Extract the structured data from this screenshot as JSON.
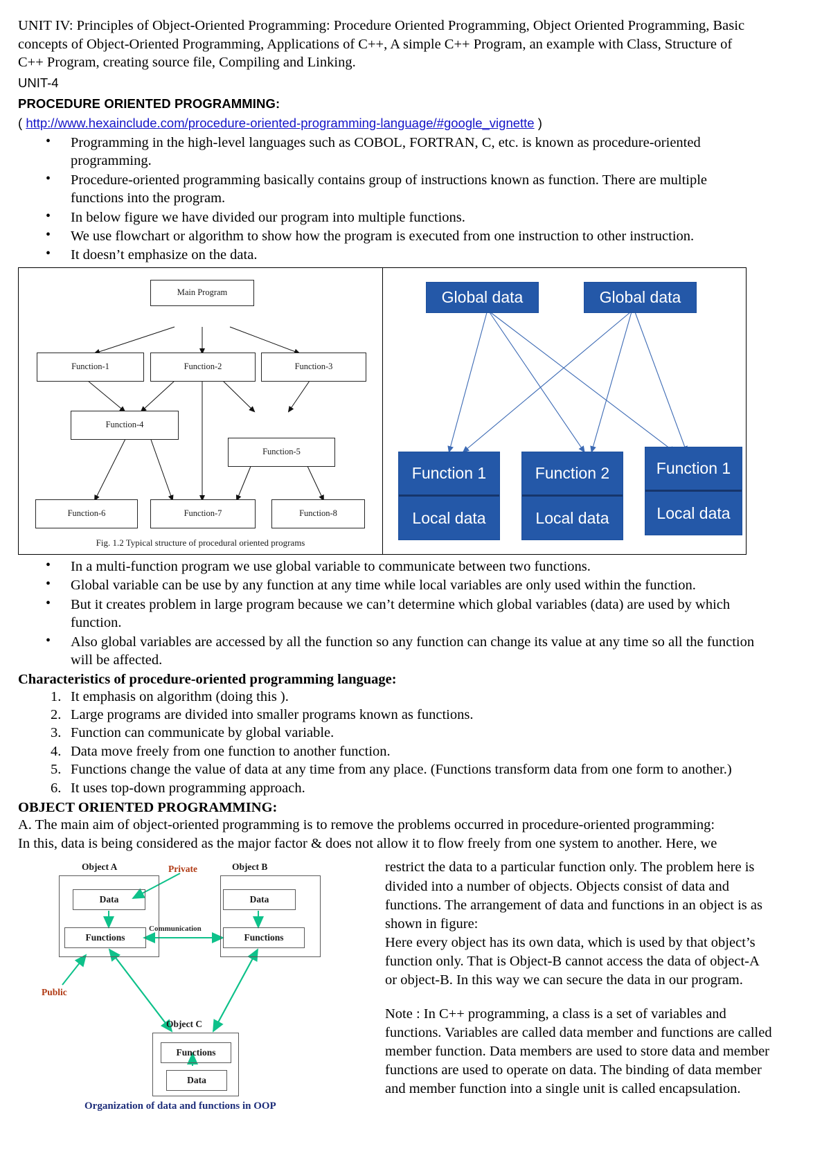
{
  "document": {
    "intro": "UNIT IV: Principles of Object-Oriented Programming: Procedure Oriented Programming, Object Oriented Programming, Basic concepts of Object-Oriented Programming, Applications of C++, A simple C++ Program, an example with Class, Structure of C++ Program, creating source file, Compiling and Linking.",
    "unit_label": "UNIT-4",
    "section1_title": "PROCEDURE ORIENTED PROGRAMMING:",
    "url_open": "( ",
    "url": "http://www.hexainclude.com/procedure-oriented-programming-language/#google_vignette",
    "url_close": " )",
    "bullets_top": [
      "Programming in the high-level languages such as COBOL, FORTRAN, C, etc. is known as procedure-oriented programming.",
      "Procedure-oriented programming basically contains group of instructions known as function. There are multiple functions into the program.",
      "In below figure we have divided our program into multiple functions.",
      "We use flowchart or algorithm to show how the program is executed from one instruction to other instruction.",
      "It doesn’t emphasize on the data."
    ],
    "bullets_after_fig": [
      "In a multi-function program we use global variable to communicate between two functions.",
      "Global variable can be use by any function at any time while local variables are only used within the function.",
      "But it creates problem in large program because we can’t determine which global variables (data) are used by which function.",
      "Also global variables are accessed by all the function so any function can change its value at any time so all the function will be affected."
    ],
    "characteristics_title": "Characteristics of procedure-oriented programming language:",
    "characteristics": [
      "It emphasis on algorithm (doing this ).",
      "Large programs are divided into smaller programs known as functions.",
      "Function can communicate by global variable.",
      "Data move freely from one function to another function.",
      "Functions change the value of data at any time from any place. (Functions transform data from one form to another.)",
      "It uses top-down programming approach."
    ],
    "section2_title": "OBJECT ORIENTED PROGRAMMING:",
    "oop_line_a": "A. The main aim of object-oriented programming is to remove the problems occurred in procedure-oriented programming:",
    "oop_line_b": "In this, data is being considered as the major factor & does not allow it to flow freely from one system to another. Here, we",
    "right_paragraph_1": "restrict the data to a particular function only. The problem here is divided into a number of objects. Objects consist of data and functions. The arrangement of data and functions in an object is as shown in figure:",
    "right_paragraph_2": "Here every object has its own data, which is used by that object’s function only. That is Object-B cannot access the data of object-A or object-B. In this      way we can secure the data in our program.",
    "right_paragraph_3": "Note : In C++ programming, a class is a set of variables and functions. Variables are called data member and functions are called member function. Data members are used to store data and member functions are used to operate on data. The binding of data member and member function into a single unit is called encapsulation."
  },
  "figure_procedural": {
    "caption": "Fig. 1.2 Typical structure of procedural oriented programs",
    "nodes": {
      "main": "Main Program",
      "f1": "Function-1",
      "f2": "Function-2",
      "f3": "Function-3",
      "f4": "Function-4",
      "f5": "Function-5",
      "f6": "Function-6",
      "f7": "Function-7",
      "f8": "Function-8"
    }
  },
  "figure_globaldata": {
    "global_left": "Global data",
    "global_right": "Global data",
    "functions": [
      {
        "title": "Function 1",
        "local": "Local data"
      },
      {
        "title": "Function 2",
        "local": "Local data"
      },
      {
        "title": "Function 1",
        "local": "Local data"
      }
    ],
    "box_color": "#2458a8",
    "arrow_color": "#3c6ab4"
  },
  "figure_oop": {
    "object_a": "Object  A",
    "object_b": "Object  B",
    "object_c": "Object  C",
    "data_label": "Data",
    "functions_label": "Functions",
    "private_label": "Private",
    "public_label": "Public",
    "communication_label": "Communication",
    "caption": "Organization of data and functions in OOP",
    "arrow_color": "#0ec18a",
    "label_color": "#b03a14",
    "caption_color": "#1d2d7a"
  }
}
